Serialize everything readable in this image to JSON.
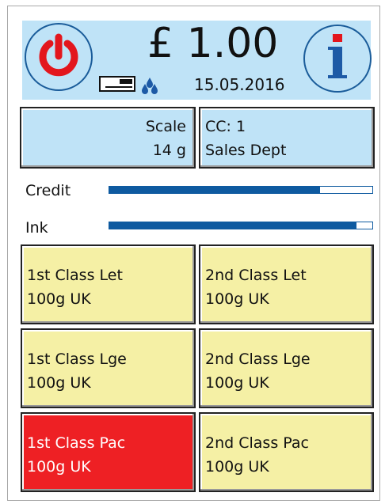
{
  "header": {
    "amount": "£ 1.00",
    "date": "15.05.2016",
    "power_icon": "power-icon",
    "info_icon": "info-icon",
    "card_icon": "card-status-icon",
    "ink_icon": "ink-drops-icon"
  },
  "scale": {
    "label": "Scale",
    "value": "14 g"
  },
  "cost_centre": {
    "code": "CC: 1",
    "name": "Sales Dept"
  },
  "meters": {
    "credit": {
      "label": "Credit",
      "level": 0.8
    },
    "ink": {
      "label": "Ink",
      "level": 0.94
    }
  },
  "services": [
    {
      "line1": "1st Class Let",
      "line2": "100g UK",
      "state": "normal"
    },
    {
      "line1": "2nd Class Let",
      "line2": "100g UK",
      "state": "normal"
    },
    {
      "line1": "1st Class Lge",
      "line2": "100g UK",
      "state": "normal"
    },
    {
      "line1": "2nd Class Lge",
      "line2": "100g UK",
      "state": "normal"
    },
    {
      "line1": "1st Class Pac",
      "line2": "100g UK",
      "state": "selected"
    },
    {
      "line1": "2nd Class Pac",
      "line2": "100g UK",
      "state": "normal"
    }
  ],
  "colors": {
    "header_bg": "#bfe3f7",
    "button_blue": "#bfe3f7",
    "button_yellow": "#f5f0a5",
    "selected_red": "#ee2024",
    "meter_blue": "#0e5aa0",
    "power_red": "#e3161d",
    "info_blue": "#1d5aa6"
  }
}
